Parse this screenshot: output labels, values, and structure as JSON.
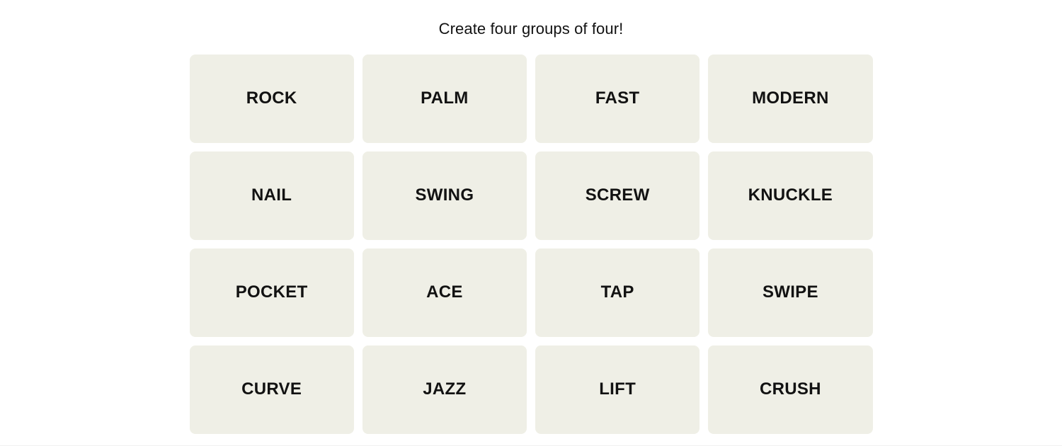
{
  "page": {
    "background_color": "#ffffff",
    "bottom_border_color": "#f1f1f1"
  },
  "header": {
    "instruction": "Create four groups of four!"
  },
  "board": {
    "columns": 4,
    "rows": 4,
    "tile_background_color": "#efefe6",
    "tile_text_color": "#121212",
    "tiles": [
      {
        "label": "ROCK"
      },
      {
        "label": "PALM"
      },
      {
        "label": "FAST"
      },
      {
        "label": "MODERN"
      },
      {
        "label": "NAIL"
      },
      {
        "label": "SWING"
      },
      {
        "label": "SCREW"
      },
      {
        "label": "KNUCKLE"
      },
      {
        "label": "POCKET"
      },
      {
        "label": "ACE"
      },
      {
        "label": "TAP"
      },
      {
        "label": "SWIPE"
      },
      {
        "label": "CURVE"
      },
      {
        "label": "JAZZ"
      },
      {
        "label": "LIFT"
      },
      {
        "label": "CRUSH"
      }
    ]
  }
}
